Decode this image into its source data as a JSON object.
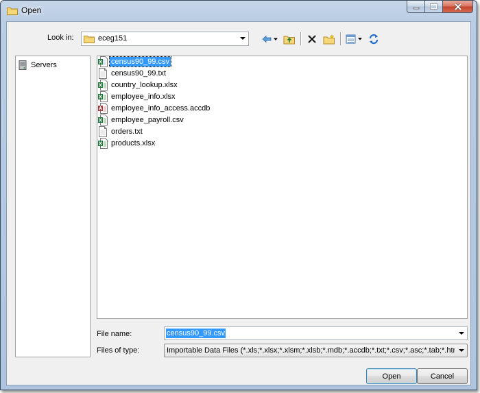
{
  "window": {
    "title": "Open"
  },
  "toolbar": {
    "look_in_label": "Look in:",
    "look_in_value": "eceg151"
  },
  "places": [
    {
      "label": "Servers"
    }
  ],
  "files": [
    {
      "name": "census90_99.csv",
      "type": "csv",
      "selected": true
    },
    {
      "name": "census90_99.txt",
      "type": "txt",
      "selected": false
    },
    {
      "name": "country_lookup.xlsx",
      "type": "xlsx",
      "selected": false
    },
    {
      "name": "employee_info.xlsx",
      "type": "xlsx",
      "selected": false
    },
    {
      "name": "employee_info_access.accdb",
      "type": "accdb",
      "selected": false
    },
    {
      "name": "employee_payroll.csv",
      "type": "csv",
      "selected": false
    },
    {
      "name": "orders.txt",
      "type": "txt",
      "selected": false
    },
    {
      "name": "products.xlsx",
      "type": "xlsx",
      "selected": false
    }
  ],
  "filename": {
    "label": "File name:",
    "value": "census90_99.csv"
  },
  "filetype": {
    "label": "Files of type:",
    "value": "Importable Data Files (*.xls;*.xlsx;*.xlsm;*.xlsb;*.mdb;*.accdb;*.txt;*.csv;*.asc;*.tab;*.htm;*.h"
  },
  "buttons": {
    "open": "Open",
    "cancel": "Cancel"
  },
  "colors": {
    "selection": "#3399ff",
    "excel": "#1d7a3a",
    "access": "#a4373a"
  }
}
